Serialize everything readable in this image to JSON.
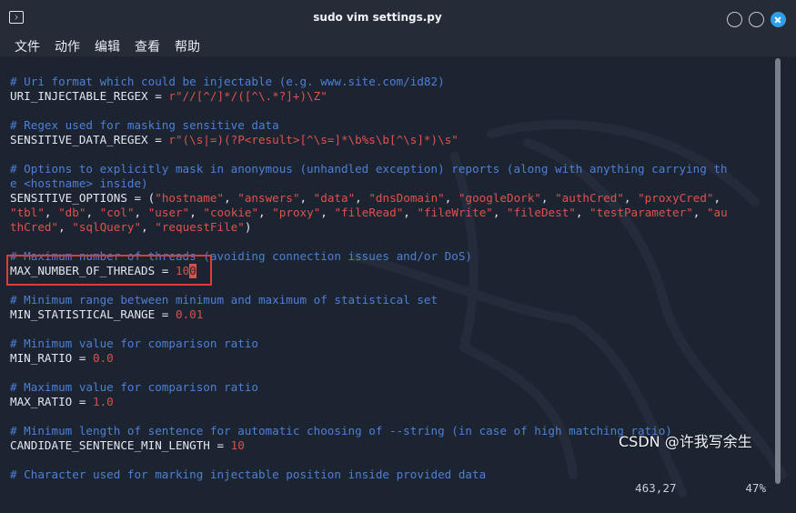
{
  "window": {
    "title": "sudo vim settings.py",
    "icon": "terminal-icon"
  },
  "menu": [
    "文件",
    "动作",
    "编辑",
    "查看",
    "帮助"
  ],
  "code_lines": [
    [
      {
        "t": "comment",
        "v": "# Uri format which could be injectable (e.g. www.site.com/id82)"
      }
    ],
    [
      {
        "t": "plain",
        "v": "URI_INJECTABLE_REGEX = "
      },
      {
        "t": "str",
        "v": "r\"//[^/]*/([^\\.*?]+)\\Z\""
      }
    ],
    [],
    [
      {
        "t": "comment",
        "v": "# Regex used for masking sensitive data"
      }
    ],
    [
      {
        "t": "plain",
        "v": "SENSITIVE_DATA_REGEX = "
      },
      {
        "t": "str",
        "v": "r\"(\\s|=)(?P<result>[^\\s=]*\\b%s\\b[^\\s]*)\\s\""
      }
    ],
    [],
    [
      {
        "t": "comment",
        "v": "# Options to explicitly mask in anonymous (unhandled exception) reports (along with anything carrying th"
      }
    ],
    [
      {
        "t": "comment",
        "v": "e <hostname> inside)"
      }
    ],
    [
      {
        "t": "plain",
        "v": "SENSITIVE_OPTIONS = ("
      },
      {
        "t": "str",
        "v": "\"hostname\""
      },
      {
        "t": "plain",
        "v": ", "
      },
      {
        "t": "str",
        "v": "\"answers\""
      },
      {
        "t": "plain",
        "v": ", "
      },
      {
        "t": "str",
        "v": "\"data\""
      },
      {
        "t": "plain",
        "v": ", "
      },
      {
        "t": "str",
        "v": "\"dnsDomain\""
      },
      {
        "t": "plain",
        "v": ", "
      },
      {
        "t": "str",
        "v": "\"googleDork\""
      },
      {
        "t": "plain",
        "v": ", "
      },
      {
        "t": "str",
        "v": "\"authCred\""
      },
      {
        "t": "plain",
        "v": ", "
      },
      {
        "t": "str",
        "v": "\"proxyCred\""
      },
      {
        "t": "plain",
        "v": ","
      }
    ],
    [
      {
        "t": "str",
        "v": "\"tbl\""
      },
      {
        "t": "plain",
        "v": ", "
      },
      {
        "t": "str",
        "v": "\"db\""
      },
      {
        "t": "plain",
        "v": ", "
      },
      {
        "t": "str",
        "v": "\"col\""
      },
      {
        "t": "plain",
        "v": ", "
      },
      {
        "t": "str",
        "v": "\"user\""
      },
      {
        "t": "plain",
        "v": ", "
      },
      {
        "t": "str",
        "v": "\"cookie\""
      },
      {
        "t": "plain",
        "v": ", "
      },
      {
        "t": "str",
        "v": "\"proxy\""
      },
      {
        "t": "plain",
        "v": ", "
      },
      {
        "t": "str",
        "v": "\"fileRead\""
      },
      {
        "t": "plain",
        "v": ", "
      },
      {
        "t": "str",
        "v": "\"fileWrite\""
      },
      {
        "t": "plain",
        "v": ", "
      },
      {
        "t": "str",
        "v": "\"fileDest\""
      },
      {
        "t": "plain",
        "v": ", "
      },
      {
        "t": "str",
        "v": "\"testParameter\""
      },
      {
        "t": "plain",
        "v": ", "
      },
      {
        "t": "str",
        "v": "\"au"
      }
    ],
    [
      {
        "t": "str",
        "v": "thCred\""
      },
      {
        "t": "plain",
        "v": ", "
      },
      {
        "t": "str",
        "v": "\"sqlQuery\""
      },
      {
        "t": "plain",
        "v": ", "
      },
      {
        "t": "str",
        "v": "\"requestFile\""
      },
      {
        "t": "plain",
        "v": ")"
      }
    ],
    [],
    [
      {
        "t": "comment",
        "v": "# Maximum number of threads (avoiding connection issues and/or DoS)"
      }
    ],
    [
      {
        "t": "plain",
        "v": "MAX_NUMBER_OF_THREADS = "
      },
      {
        "t": "num",
        "v": "10"
      },
      {
        "t": "cursor",
        "v": "0"
      }
    ],
    [],
    [
      {
        "t": "comment",
        "v": "# Minimum range between minimum and maximum of statistical set"
      }
    ],
    [
      {
        "t": "plain",
        "v": "MIN_STATISTICAL_RANGE = "
      },
      {
        "t": "num",
        "v": "0.01"
      }
    ],
    [],
    [
      {
        "t": "comment",
        "v": "# Minimum value for comparison ratio"
      }
    ],
    [
      {
        "t": "plain",
        "v": "MIN_RATIO = "
      },
      {
        "t": "num",
        "v": "0.0"
      }
    ],
    [],
    [
      {
        "t": "comment",
        "v": "# Maximum value for comparison ratio"
      }
    ],
    [
      {
        "t": "plain",
        "v": "MAX_RATIO = "
      },
      {
        "t": "num",
        "v": "1.0"
      }
    ],
    [],
    [
      {
        "t": "comment",
        "v": "# Minimum length of sentence for automatic choosing of --string (in case of high matching ratio)"
      }
    ],
    [
      {
        "t": "plain",
        "v": "CANDIDATE_SENTENCE_MIN_LENGTH = "
      },
      {
        "t": "num",
        "v": "10"
      }
    ],
    [],
    [
      {
        "t": "comment",
        "v": "# Character used for marking injectable position inside provided data"
      }
    ]
  ],
  "status": {
    "position": "463,27",
    "percent": "47%"
  },
  "watermark": "CSDN @许我写余生",
  "colors": {
    "background": "#1d2431",
    "comment": "#4d7fd6",
    "string": "#e0514c",
    "highlight_box": "#e03a3a",
    "close_button": "#2f9ee8"
  }
}
